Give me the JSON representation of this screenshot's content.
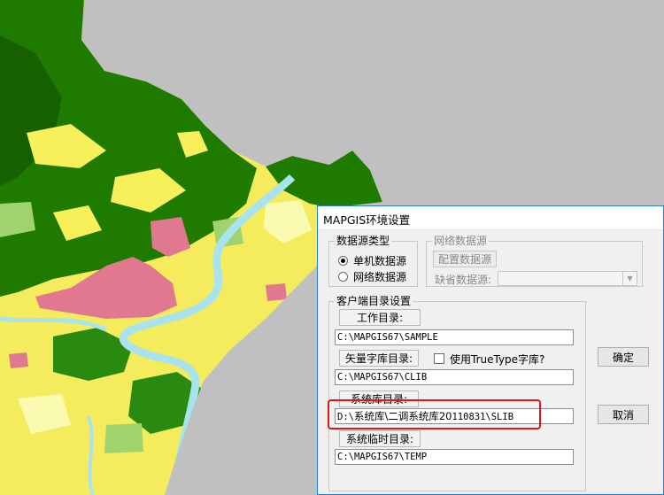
{
  "map": {
    "background_color": "#c0c0c0",
    "colors": {
      "forest": "#1f7a00",
      "forest_dark": "#166000",
      "farmland": "#f7f05a",
      "grass": "#9fd36d",
      "urban": "#e07890",
      "river": "#a9e4ee",
      "light": "#fafab0"
    }
  },
  "dialog": {
    "title": "MAPGIS环境设置",
    "border_color": "#2b7bd0",
    "data_source_type": {
      "label": "数据源类型",
      "options": [
        {
          "label": "单机数据源",
          "selected": true
        },
        {
          "label": "网络数据源",
          "selected": false
        }
      ]
    },
    "network_data_source": {
      "label": "网络数据源",
      "config_button": "配置数据源",
      "default_label": "缺省数据源:",
      "default_value": ""
    },
    "client_dirs": {
      "label": "客户端目录设置",
      "work_dir": {
        "button": "工作目录:",
        "value": "C:\\MAPGIS67\\SAMPLE"
      },
      "vector_lib": {
        "button": "矢量字库目录:",
        "value": "C:\\MAPGIS67\\CLIB"
      },
      "truetype": {
        "label": "使用TrueType字库?",
        "checked": false
      },
      "system_lib": {
        "button": "系统库目录:",
        "value_prefix": "D:\\",
        "value_cjk": "系统库\\二调系统库20",
        "value_suffix": "110831\\SLIB"
      },
      "temp_dir": {
        "button": "系统临时目录:",
        "value": "C:\\MAPGIS67\\TEMP"
      }
    },
    "ok_button": "确定",
    "cancel_button": "取消",
    "highlight_color": "#e0141a"
  }
}
